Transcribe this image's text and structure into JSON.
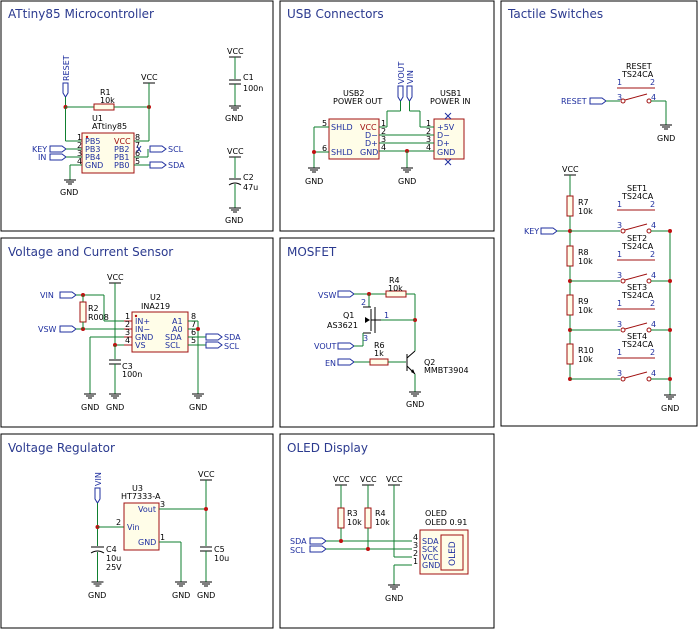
{
  "panels": {
    "attiny": "ATtiny85 Microcontroller",
    "usb": "USB Connectors",
    "tactile": "Tactile Switches",
    "vcs": "Voltage and Current Sensor",
    "mosfet": "MOSFET",
    "vreg": "Voltage Regulator",
    "oled": "OLED Display"
  },
  "attiny": {
    "reset_label": "RESET",
    "vcc": "VCC",
    "r1_ref": "R1",
    "r1_val": "10k",
    "u1_ref": "U1",
    "u1_val": "ATtiny85",
    "key": "KEY",
    "in": "IN",
    "gnd": "GND",
    "pin_pb5": "PB5",
    "pin_pb3": "PB3",
    "pin_pb4": "PB4",
    "pin_gnd": "GND",
    "pin_vcc": "VCC",
    "pin_pb2": "PB2",
    "pin_pb1": "PB1",
    "pin_pb0": "PB0",
    "n1": "1",
    "n2": "2",
    "n3": "3",
    "n4": "4",
    "n5": "5",
    "n6": "6",
    "n7": "7",
    "n8": "8",
    "scl": "SCL",
    "sda": "SDA",
    "c1_vcc": "VCC",
    "c1_ref": "C1",
    "c1_val": "100n",
    "c1_gnd": "GND",
    "c2_vcc": "VCC",
    "c2_ref": "C2",
    "c2_val": "47u",
    "c2_gnd": "GND"
  },
  "usb": {
    "vout": "VOUT",
    "vin": "VIN",
    "usb2_ref": "USB2",
    "usb2_val": "POWER OUT",
    "usb1_ref": "USB1",
    "usb1_val": "POWER IN",
    "p_shld": "SHLD",
    "p_vcc": "VCC",
    "p_dm": "D−",
    "p_dp": "D+",
    "p_gnd": "GND",
    "p_5v": "+5V",
    "n1": "1",
    "n2": "2",
    "n3": "3",
    "n4": "4",
    "n5": "5",
    "n6": "6",
    "gnd": "GND"
  },
  "tactile": {
    "reset_ref": "RESET",
    "reset_val": "TS24CA",
    "reset_net": "RESET",
    "key": "KEY",
    "vcc": "VCC",
    "gnd": "GND",
    "r7": "R7",
    "r8": "R8",
    "r9": "R9",
    "r10": "R10",
    "r_val": "10k",
    "set1": "SET1",
    "set2": "SET2",
    "set3": "SET3",
    "set4": "SET4",
    "sw_val": "TS24CA",
    "n1": "1",
    "n2": "2",
    "n3": "3",
    "n4": "4"
  },
  "vcs": {
    "vin": "VIN",
    "vsw": "VSW",
    "vcc": "VCC",
    "r2_ref": "R2",
    "r2_val": "R008",
    "u2_ref": "U2",
    "u2_val": "INA219",
    "p_inp": "IN+",
    "p_inm": "IN−",
    "p_gnd": "GND",
    "p_vs": "VS",
    "p_a1": "A1",
    "p_a0": "A0",
    "p_sda": "SDA",
    "p_scl": "SCL",
    "n1": "1",
    "n2": "2",
    "n3": "3",
    "n4": "4",
    "n5": "5",
    "n6": "6",
    "n7": "7",
    "n8": "8",
    "sda": "SDA",
    "scl": "SCL",
    "c3_ref": "C3",
    "c3_val": "100n",
    "gnd": "GND"
  },
  "mosfet": {
    "vsw": "VSW",
    "vout": "VOUT",
    "en": "EN",
    "r4_ref": "R4",
    "r4_val": "10k",
    "r6_ref": "R6",
    "r6_val": "1k",
    "q1_ref": "Q1",
    "q1_val": "AS3621",
    "q2_ref": "Q2",
    "q2_val": "MMBT3904",
    "n1": "1",
    "n2": "2",
    "n3": "3",
    "gnd": "GND"
  },
  "vreg": {
    "vin": "VIN",
    "vcc": "VCC",
    "u3_ref": "U3",
    "u3_val": "HT7333-A",
    "p_vin": "Vin",
    "p_vout": "Vout",
    "p_gnd": "GND",
    "n1": "1",
    "n2": "2",
    "n3": "3",
    "c4_ref": "C4",
    "c4_val": "10u",
    "c4_v": "25V",
    "c5_ref": "C5",
    "c5_val": "10u",
    "gnd": "GND"
  },
  "oled": {
    "vcc": "VCC",
    "r3_ref": "R3",
    "r4_ref": "R4",
    "r_val": "10k",
    "sda": "SDA",
    "scl": "SCL",
    "ref": "OLED",
    "val": "OLED 0.91",
    "body_label": "OLED",
    "p_sda": "SDA",
    "p_sck": "SCK",
    "p_vcc": "VCC",
    "p_gnd": "GND",
    "n1": "1",
    "n2": "2",
    "n3": "3",
    "n4": "4",
    "gnd": "GND"
  },
  "colors": {
    "wire": "#0f7f2f",
    "symbol": "#a01010",
    "label": "#1f2f9f",
    "junction": "#c01010",
    "title": "#2b3a8f"
  }
}
